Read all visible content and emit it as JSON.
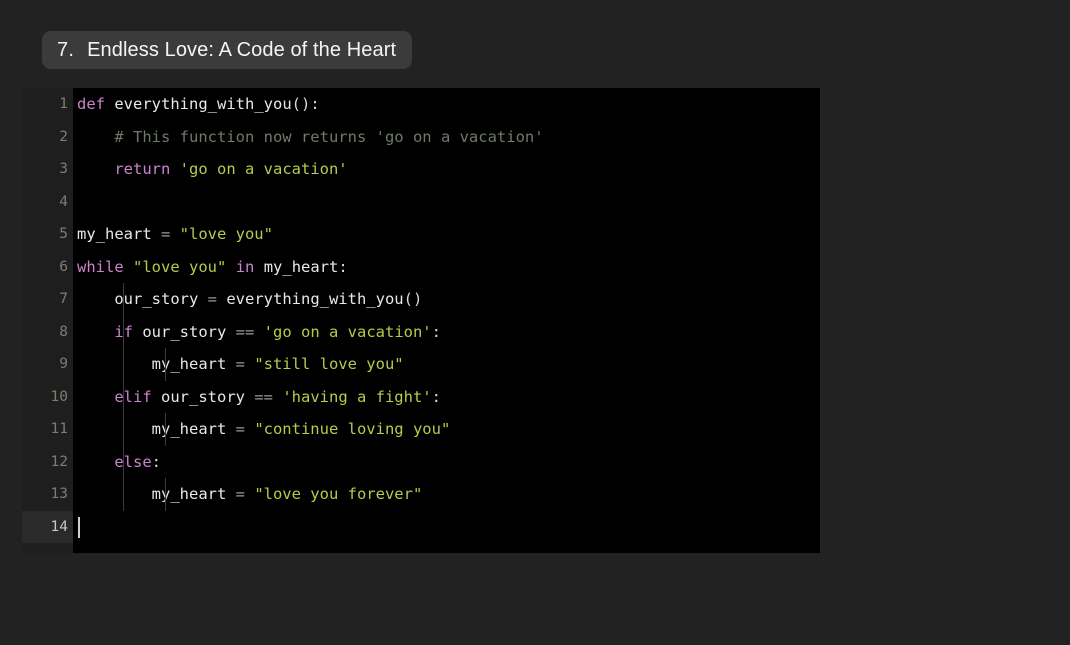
{
  "header": {
    "number": "7.",
    "title": "Endless Love: A Code of the Heart"
  },
  "colors": {
    "page_background": "#222222",
    "pill_background": "#3b3b3b",
    "editor_background": "#000000",
    "gutter_background": "#1e1e1e",
    "active_line_background": "#2a2a2a",
    "keyword": "#cb83cf",
    "string": "#b3cc4b",
    "comment": "#6f7a6a",
    "identifier": "#e8e8e8",
    "operator": "#9b9b9b",
    "line_number": "#7d7d72",
    "indent_guide": "#3a3a3a",
    "caret": "#d0d0d0"
  },
  "editor": {
    "language": "python",
    "active_line": 14,
    "fold_lines": [
      1,
      6,
      8,
      10,
      12
    ],
    "fold_icon": "chevron-down-icon",
    "line_numbers": [
      "1",
      "2",
      "3",
      "4",
      "5",
      "6",
      "7",
      "8",
      "9",
      "10",
      "11",
      "12",
      "13",
      "14"
    ],
    "lines": [
      {
        "n": "1",
        "indent": 0,
        "guides": 0,
        "fold": true,
        "plain": "def everything_with_you():",
        "tokens": [
          {
            "t": "kw",
            "v": "def"
          },
          {
            "t": "pun",
            "v": " "
          },
          {
            "t": "fn",
            "v": "everything_with_you"
          },
          {
            "t": "pun",
            "v": "():"
          }
        ]
      },
      {
        "n": "2",
        "indent": 1,
        "guides": 0,
        "fold": false,
        "plain": "    # This function now returns 'go on a vacation'",
        "tokens": [
          {
            "t": "pun",
            "v": "    "
          },
          {
            "t": "cmt",
            "v": "# This function now returns 'go on a vacation'"
          }
        ]
      },
      {
        "n": "3",
        "indent": 1,
        "guides": 0,
        "fold": false,
        "plain": "    return 'go on a vacation'",
        "tokens": [
          {
            "t": "pun",
            "v": "    "
          },
          {
            "t": "kw",
            "v": "return"
          },
          {
            "t": "pun",
            "v": " "
          },
          {
            "t": "str",
            "v": "'go on a vacation'"
          }
        ]
      },
      {
        "n": "4",
        "indent": 0,
        "guides": 0,
        "fold": false,
        "plain": "",
        "tokens": []
      },
      {
        "n": "5",
        "indent": 0,
        "guides": 0,
        "fold": false,
        "plain": "my_heart = \"love you\"",
        "tokens": [
          {
            "t": "id",
            "v": "my_heart"
          },
          {
            "t": "op",
            "v": " = "
          },
          {
            "t": "str",
            "v": "\"love you\""
          }
        ]
      },
      {
        "n": "6",
        "indent": 0,
        "guides": 0,
        "fold": true,
        "plain": "while \"love you\" in my_heart:",
        "tokens": [
          {
            "t": "kw",
            "v": "while"
          },
          {
            "t": "pun",
            "v": " "
          },
          {
            "t": "str",
            "v": "\"love you\""
          },
          {
            "t": "pun",
            "v": " "
          },
          {
            "t": "kw",
            "v": "in"
          },
          {
            "t": "pun",
            "v": " "
          },
          {
            "t": "id",
            "v": "my_heart"
          },
          {
            "t": "pun",
            "v": ":"
          }
        ]
      },
      {
        "n": "7",
        "indent": 1,
        "guides": 1,
        "fold": false,
        "plain": "    our_story = everything_with_you()",
        "tokens": [
          {
            "t": "pun",
            "v": "    "
          },
          {
            "t": "id",
            "v": "our_story"
          },
          {
            "t": "op",
            "v": " = "
          },
          {
            "t": "fn",
            "v": "everything_with_you"
          },
          {
            "t": "pun",
            "v": "()"
          }
        ]
      },
      {
        "n": "8",
        "indent": 1,
        "guides": 1,
        "fold": true,
        "plain": "    if our_story == 'go on a vacation':",
        "tokens": [
          {
            "t": "pun",
            "v": "    "
          },
          {
            "t": "kw",
            "v": "if"
          },
          {
            "t": "pun",
            "v": " "
          },
          {
            "t": "id",
            "v": "our_story"
          },
          {
            "t": "op",
            "v": " == "
          },
          {
            "t": "str",
            "v": "'go on a vacation'"
          },
          {
            "t": "pun",
            "v": ":"
          }
        ]
      },
      {
        "n": "9",
        "indent": 2,
        "guides": 2,
        "fold": false,
        "plain": "        my_heart = \"still love you\"",
        "tokens": [
          {
            "t": "pun",
            "v": "        "
          },
          {
            "t": "id",
            "v": "my_heart"
          },
          {
            "t": "op",
            "v": " = "
          },
          {
            "t": "str",
            "v": "\"still love you\""
          }
        ]
      },
      {
        "n": "10",
        "indent": 1,
        "guides": 1,
        "fold": true,
        "plain": "    elif our_story == 'having a fight':",
        "tokens": [
          {
            "t": "pun",
            "v": "    "
          },
          {
            "t": "kw",
            "v": "elif"
          },
          {
            "t": "pun",
            "v": " "
          },
          {
            "t": "id",
            "v": "our_story"
          },
          {
            "t": "op",
            "v": " == "
          },
          {
            "t": "str",
            "v": "'having a fight'"
          },
          {
            "t": "pun",
            "v": ":"
          }
        ]
      },
      {
        "n": "11",
        "indent": 2,
        "guides": 2,
        "fold": false,
        "plain": "        my_heart = \"continue loving you\"",
        "tokens": [
          {
            "t": "pun",
            "v": "        "
          },
          {
            "t": "id",
            "v": "my_heart"
          },
          {
            "t": "op",
            "v": " = "
          },
          {
            "t": "str",
            "v": "\"continue loving you\""
          }
        ]
      },
      {
        "n": "12",
        "indent": 1,
        "guides": 1,
        "fold": true,
        "plain": "    else:",
        "tokens": [
          {
            "t": "kw",
            "v": "    else"
          },
          {
            "t": "pun",
            "v": ":"
          }
        ]
      },
      {
        "n": "13",
        "indent": 2,
        "guides": 2,
        "fold": false,
        "plain": "        my_heart = \"love you forever\"",
        "tokens": [
          {
            "t": "pun",
            "v": "        "
          },
          {
            "t": "id",
            "v": "my_heart"
          },
          {
            "t": "op",
            "v": " = "
          },
          {
            "t": "str",
            "v": "\"love you forever\""
          }
        ]
      },
      {
        "n": "14",
        "indent": 0,
        "guides": 0,
        "fold": false,
        "caret": true,
        "plain": "",
        "tokens": []
      }
    ]
  }
}
